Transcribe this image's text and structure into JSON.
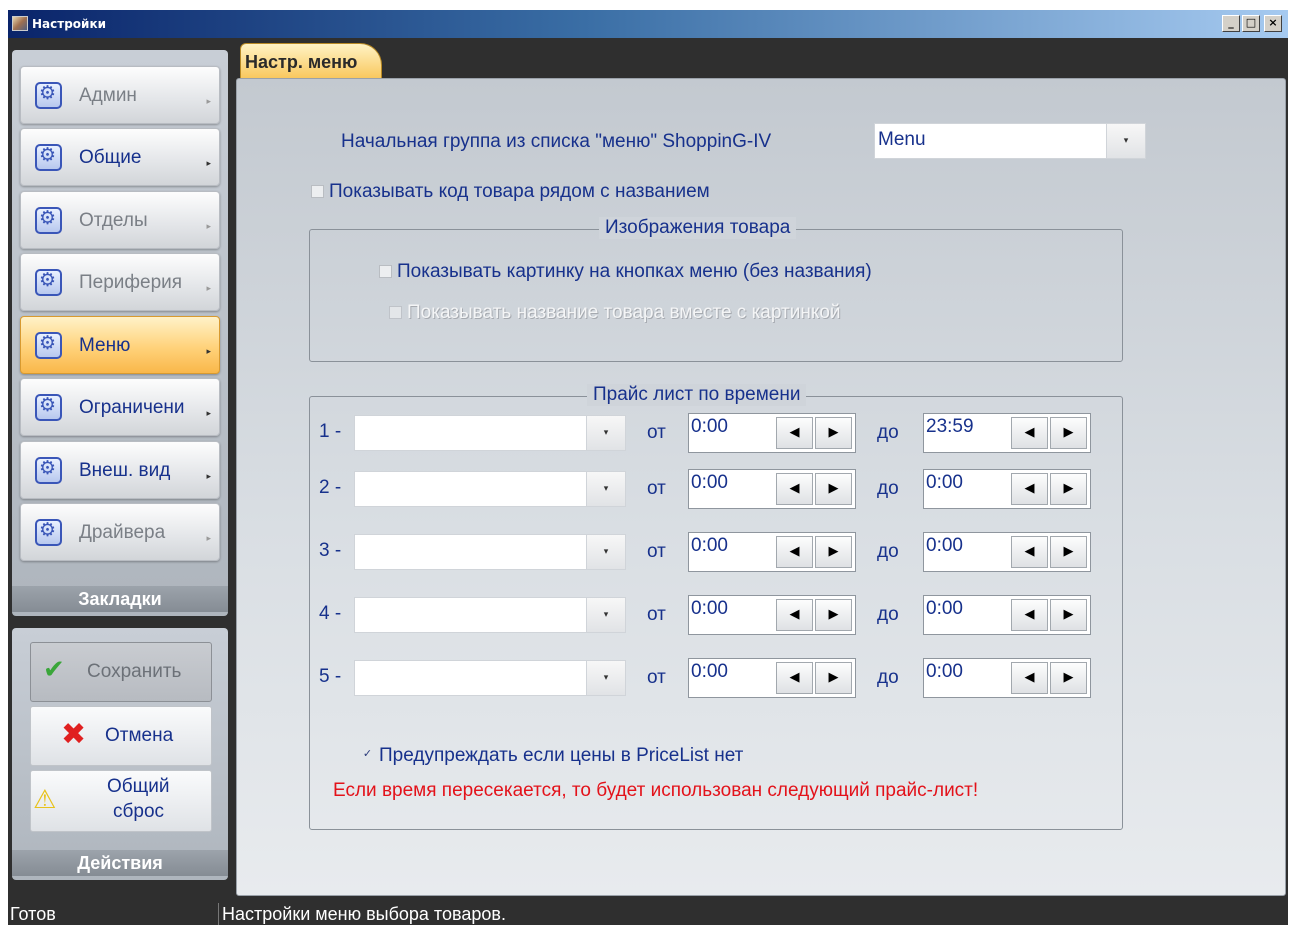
{
  "window": {
    "title": "Настройки",
    "minimize": "_",
    "maximize": "□",
    "close": "×"
  },
  "sidebar": {
    "section_label": "Закладки",
    "items": [
      {
        "label": "Админ",
        "state": "disabled"
      },
      {
        "label": "Общие",
        "state": "normal"
      },
      {
        "label": "Отделы",
        "state": "disabled"
      },
      {
        "label": "Периферия",
        "state": "disabled"
      },
      {
        "label": "Меню",
        "state": "active"
      },
      {
        "label": "Ограничени",
        "state": "normal"
      },
      {
        "label": "Внеш. вид",
        "state": "normal"
      },
      {
        "label": "Драйвера",
        "state": "disabled"
      }
    ]
  },
  "actions": {
    "section_label": "Действия",
    "save": "Сохранить",
    "cancel": "Отмена",
    "reset_line1": "Общий",
    "reset_line2": "сброс"
  },
  "tab": {
    "label": "Настр. меню"
  },
  "main": {
    "start_group_label": "Начальная группа из списка \"меню\" ShoppinG-IV",
    "start_group_value": "Menu",
    "show_code_label": "Показывать код товара рядом с названием",
    "show_code_checked": false,
    "images_group": {
      "title": "Изображения товара",
      "show_picture_label": "Показывать картинку на кнопках меню (без названия)",
      "show_picture_checked": false,
      "show_name_label": "Показывать название товара вместе с картинкой",
      "show_name_checked": false,
      "show_name_disabled": true
    },
    "price_group": {
      "title": "Прайс лист по времени",
      "from_label": "от",
      "to_label": "до",
      "rows": [
        {
          "index": "1 -",
          "value": "",
          "from": "0:00",
          "to": "23:59"
        },
        {
          "index": "2 -",
          "value": "",
          "from": "0:00",
          "to": "0:00"
        },
        {
          "index": "3 -",
          "value": "",
          "from": "0:00",
          "to": "0:00"
        },
        {
          "index": "4 -",
          "value": "",
          "from": "0:00",
          "to": "0:00"
        },
        {
          "index": "5 -",
          "value": "",
          "from": "0:00",
          "to": "0:00"
        }
      ],
      "warn_label": "Предупреждать если цены в PriceList нет",
      "warn_checked": true,
      "warning_text": "Если время пересекается, то будет использован следующий прайс-лист!"
    }
  },
  "status": {
    "left": "Готов",
    "right": "Настройки меню выбора товаров."
  },
  "colors": {
    "accent_text": "#17318c",
    "active_tab": "#f9c85e",
    "warning": "#e3121a"
  }
}
